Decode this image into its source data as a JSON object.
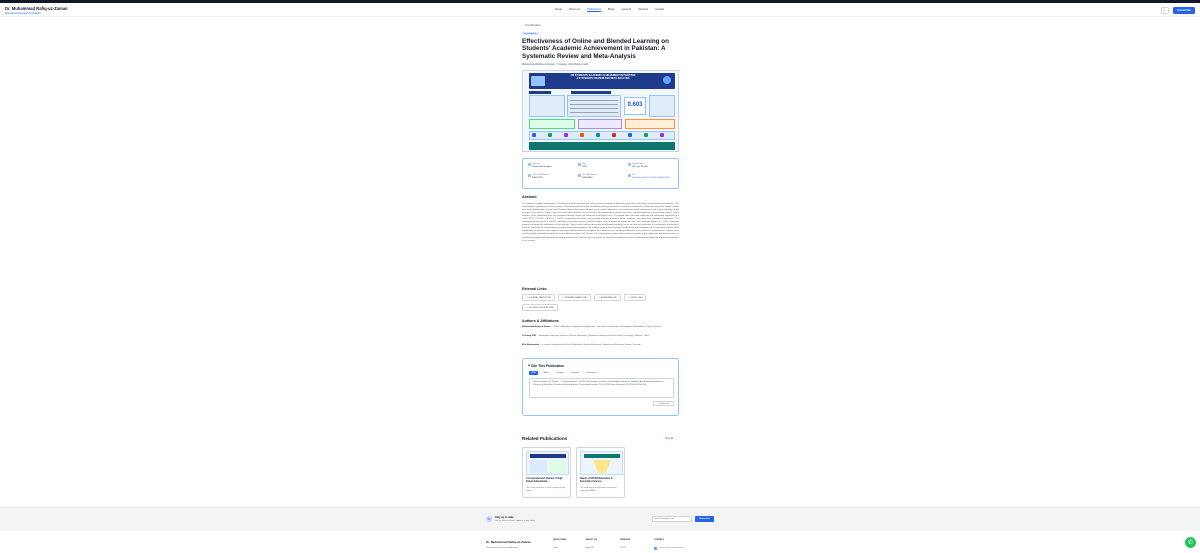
{
  "header": {
    "brand_name": "Dr. Muhammad Rafiq-uz-Zaman",
    "brand_subtitle": "Educational Research & Analytics",
    "nav": [
      "Home",
      "About me",
      "Publications",
      "Blogs",
      "Learn AI",
      "Services",
      "Contact"
    ],
    "active_nav": "Publications",
    "theme_icon": "☾",
    "consult_button": "Consult Me"
  },
  "publication": {
    "back_link": "← All publications",
    "badge": "Journal Article",
    "title": "Effectiveness of Online and Blended Learning on Students' Academic Achievement in Pakistan: A Systematic Review and Meta-Analysis",
    "authors": "Muhammad Rafiq-uz-Zaman, Yi Huang, Kifu Muhammadi",
    "figure": {
      "title_line1": "ON STUDENTS' ACADEMIC ACHIEVEMENT IN PAKISTAN",
      "title_line2": "A SYSTEMATIC REVIEW AND META-ANALYSIS",
      "stat": "0.603"
    },
    "meta": [
      {
        "icon": "book-icon",
        "label": "Published",
        "value": "Preferential Insights"
      },
      {
        "icon": "calendar-icon",
        "label": "Year",
        "value": "2025"
      },
      {
        "icon": "pages-icon",
        "label": "Volume/Pages",
        "value": "2(1), pp. 92-133"
      },
      {
        "icon": "issn-icon",
        "label": "Online ISSN Number",
        "value": "3006-7707"
      },
      {
        "icon": "issn-icon",
        "label": "Print ISSN Number",
        "value": "3006-8940"
      },
      {
        "icon": "link-icon",
        "label": "DOI",
        "value": "https://doi.org/10.70772/pi.2025a.0102"
      }
    ]
  },
  "abstract": {
    "heading": "Abstract",
    "text": "The adoption of digital pedagogies in Pakistan has been very fast and critical review is needed to determine what effect they have on the student performance. This meta-analysis synthesizes primary studies to determine whether online and blended learning enhances academic achievement in Pakistan using three eligible studies from Sindh (Hyderabad, Karachi) and Punjab (Lahore) universities. Hedges g was used to adjust bias associated with small sample sizes and to give a greater weight to larger, more precise studies, with consistent effect direction across contexts. A random-effects model was used, and heterogeneity was assessed using I² and Q statistics, while publication bias was examined through funnel plot inspection and Egger's test. The pooled effect size was moderate and statistically significant (g = 0.603, 95% CI [0.387, 0.818], p < 0.001), suggesting that online and blended learning produced better academic outcomes than traditional approaches. The heterogeneity was low (I² = 0.00%), indicating consistency across included studies, and no significant publication bias was detected (Egger's p > 0.05). Sensitivity analysis confirmed the robustness of the findings. These results indicate that online and blended learning can be an effective alternative to conventional instruction in Pakistan, although the small number of studies limits generalizability. The findings support the integration of digital learning strategies into the education system, while highlighting the need for more rigorous and large-scale research to strengthen the evidence base, including moderators such as learner characteristics, subject areas and the quality of digital infrastructure across different regions of Pakistan. The meta-analysis offers robust empirical evidence that online and blended learning can contribute to significantly improving academic outcomes in Pakistan, which presents an important foundation in terms of educational policy and digital transformation in the country."
  },
  "external_links": {
    "heading": "External Links",
    "items": [
      "JOURNAL PAPER LINK",
      "RESEARCHGATE LINK",
      "ACADEMIA LINK",
      "ORCID LINK",
      "GOOGLE SCHOLAR LINK"
    ]
  },
  "authors_section": {
    "heading": "Authors & Affiliations",
    "items": [
      {
        "name": "Muhammad Rafiq-uz-Zaman",
        "detail": " — PhD in Education, Department of Education, The Islamia University of Bahawalpur, Bahawalpur, Punjab, Pakistan"
      },
      {
        "name": "Yi Huang PhD",
        "detail": " — Associate Professor, School of Teacher Education, Qingzhou University of Science and Technology, Guizhou, China"
      },
      {
        "name": "Kifu Muhammadi",
        "detail": " — Lecturer, Department of Early Childhood & Teacher Education, University of Education Lahore, Pakistan"
      }
    ]
  },
  "cite": {
    "heading": "Cite This Publication",
    "tabs": [
      "APA",
      "MLA",
      "Chicago",
      "Harvard",
      "Vancouver"
    ],
    "active_tab": "APA",
    "text": "Rafiq-uz-Zaman, M., Huang, Y., & Muhammadi, K. (2025). Effectiveness of Online and Blended Learning on Students' Academic Achievement in Pakistan: A Systematic Review and Meta-Analysis. Preferential Insights, 2(1), 92-133. https://doi.org/10.70772/pi.2025a.0102",
    "copy_label": "⎘ Copy Text"
  },
  "related": {
    "heading": "Related Publications",
    "view_all": "View all →",
    "items": [
      {
        "title": "A Comprehensive Review of High-Impact Educational...",
        "desc": "This review examines a critical analysis of high-impact..."
      },
      {
        "title": "Needs of STEAM Education in Secondary Science...",
        "desc": "This study examines educators' perceptions regarding STEAM..."
      }
    ]
  },
  "newsletter": {
    "icon": "✉",
    "title": "Stay up to date",
    "subtitle": "Get the latest research updates in your inbox",
    "placeholder": "you@example.com",
    "button": "Subscribe"
  },
  "footer": {
    "name": "Dr. Muhammad Rafiq-uz-Zaman",
    "description": "Educational Researcher and Academic",
    "col1": "QUICK LINKS",
    "col1_first": "Home",
    "col2": "ABOUT US",
    "col2_first": "About Me",
    "col3": "PROFILES",
    "col3_first": "ORCID",
    "col4": "CONTACT",
    "col4_first": "contact@rafiq-uz-zaman.com"
  },
  "whatsapp_icon": "✆",
  "colors": {
    "accent": "#2563eb",
    "figure_band": "#1e3a8a",
    "whatsapp": "#22c55e"
  }
}
